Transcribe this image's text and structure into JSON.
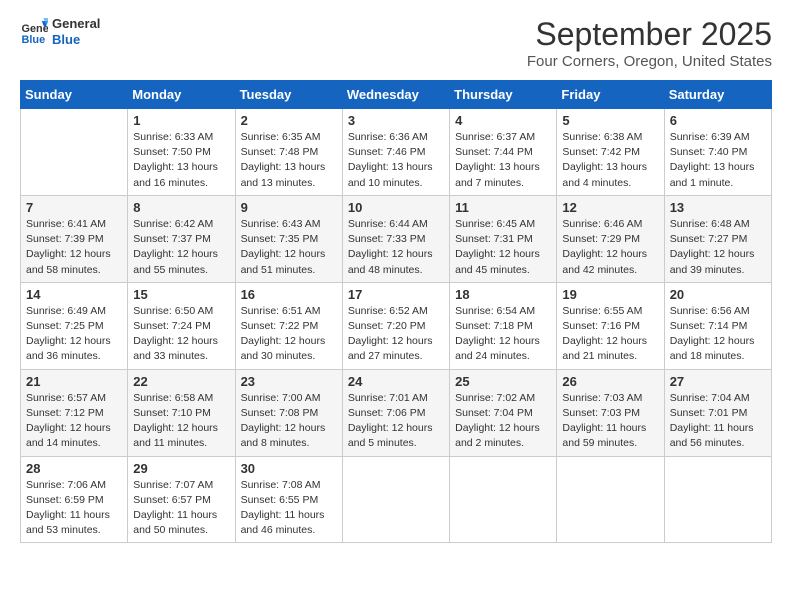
{
  "header": {
    "logo_line1": "General",
    "logo_line2": "Blue",
    "month": "September 2025",
    "location": "Four Corners, Oregon, United States"
  },
  "days_of_week": [
    "Sunday",
    "Monday",
    "Tuesday",
    "Wednesday",
    "Thursday",
    "Friday",
    "Saturday"
  ],
  "weeks": [
    [
      {
        "day": "",
        "info": ""
      },
      {
        "day": "1",
        "info": "Sunrise: 6:33 AM\nSunset: 7:50 PM\nDaylight: 13 hours\nand 16 minutes."
      },
      {
        "day": "2",
        "info": "Sunrise: 6:35 AM\nSunset: 7:48 PM\nDaylight: 13 hours\nand 13 minutes."
      },
      {
        "day": "3",
        "info": "Sunrise: 6:36 AM\nSunset: 7:46 PM\nDaylight: 13 hours\nand 10 minutes."
      },
      {
        "day": "4",
        "info": "Sunrise: 6:37 AM\nSunset: 7:44 PM\nDaylight: 13 hours\nand 7 minutes."
      },
      {
        "day": "5",
        "info": "Sunrise: 6:38 AM\nSunset: 7:42 PM\nDaylight: 13 hours\nand 4 minutes."
      },
      {
        "day": "6",
        "info": "Sunrise: 6:39 AM\nSunset: 7:40 PM\nDaylight: 13 hours\nand 1 minute."
      }
    ],
    [
      {
        "day": "7",
        "info": "Sunrise: 6:41 AM\nSunset: 7:39 PM\nDaylight: 12 hours\nand 58 minutes."
      },
      {
        "day": "8",
        "info": "Sunrise: 6:42 AM\nSunset: 7:37 PM\nDaylight: 12 hours\nand 55 minutes."
      },
      {
        "day": "9",
        "info": "Sunrise: 6:43 AM\nSunset: 7:35 PM\nDaylight: 12 hours\nand 51 minutes."
      },
      {
        "day": "10",
        "info": "Sunrise: 6:44 AM\nSunset: 7:33 PM\nDaylight: 12 hours\nand 48 minutes."
      },
      {
        "day": "11",
        "info": "Sunrise: 6:45 AM\nSunset: 7:31 PM\nDaylight: 12 hours\nand 45 minutes."
      },
      {
        "day": "12",
        "info": "Sunrise: 6:46 AM\nSunset: 7:29 PM\nDaylight: 12 hours\nand 42 minutes."
      },
      {
        "day": "13",
        "info": "Sunrise: 6:48 AM\nSunset: 7:27 PM\nDaylight: 12 hours\nand 39 minutes."
      }
    ],
    [
      {
        "day": "14",
        "info": "Sunrise: 6:49 AM\nSunset: 7:25 PM\nDaylight: 12 hours\nand 36 minutes."
      },
      {
        "day": "15",
        "info": "Sunrise: 6:50 AM\nSunset: 7:24 PM\nDaylight: 12 hours\nand 33 minutes."
      },
      {
        "day": "16",
        "info": "Sunrise: 6:51 AM\nSunset: 7:22 PM\nDaylight: 12 hours\nand 30 minutes."
      },
      {
        "day": "17",
        "info": "Sunrise: 6:52 AM\nSunset: 7:20 PM\nDaylight: 12 hours\nand 27 minutes."
      },
      {
        "day": "18",
        "info": "Sunrise: 6:54 AM\nSunset: 7:18 PM\nDaylight: 12 hours\nand 24 minutes."
      },
      {
        "day": "19",
        "info": "Sunrise: 6:55 AM\nSunset: 7:16 PM\nDaylight: 12 hours\nand 21 minutes."
      },
      {
        "day": "20",
        "info": "Sunrise: 6:56 AM\nSunset: 7:14 PM\nDaylight: 12 hours\nand 18 minutes."
      }
    ],
    [
      {
        "day": "21",
        "info": "Sunrise: 6:57 AM\nSunset: 7:12 PM\nDaylight: 12 hours\nand 14 minutes."
      },
      {
        "day": "22",
        "info": "Sunrise: 6:58 AM\nSunset: 7:10 PM\nDaylight: 12 hours\nand 11 minutes."
      },
      {
        "day": "23",
        "info": "Sunrise: 7:00 AM\nSunset: 7:08 PM\nDaylight: 12 hours\nand 8 minutes."
      },
      {
        "day": "24",
        "info": "Sunrise: 7:01 AM\nSunset: 7:06 PM\nDaylight: 12 hours\nand 5 minutes."
      },
      {
        "day": "25",
        "info": "Sunrise: 7:02 AM\nSunset: 7:04 PM\nDaylight: 12 hours\nand 2 minutes."
      },
      {
        "day": "26",
        "info": "Sunrise: 7:03 AM\nSunset: 7:03 PM\nDaylight: 11 hours\nand 59 minutes."
      },
      {
        "day": "27",
        "info": "Sunrise: 7:04 AM\nSunset: 7:01 PM\nDaylight: 11 hours\nand 56 minutes."
      }
    ],
    [
      {
        "day": "28",
        "info": "Sunrise: 7:06 AM\nSunset: 6:59 PM\nDaylight: 11 hours\nand 53 minutes."
      },
      {
        "day": "29",
        "info": "Sunrise: 7:07 AM\nSunset: 6:57 PM\nDaylight: 11 hours\nand 50 minutes."
      },
      {
        "day": "30",
        "info": "Sunrise: 7:08 AM\nSunset: 6:55 PM\nDaylight: 11 hours\nand 46 minutes."
      },
      {
        "day": "",
        "info": ""
      },
      {
        "day": "",
        "info": ""
      },
      {
        "day": "",
        "info": ""
      },
      {
        "day": "",
        "info": ""
      }
    ]
  ]
}
